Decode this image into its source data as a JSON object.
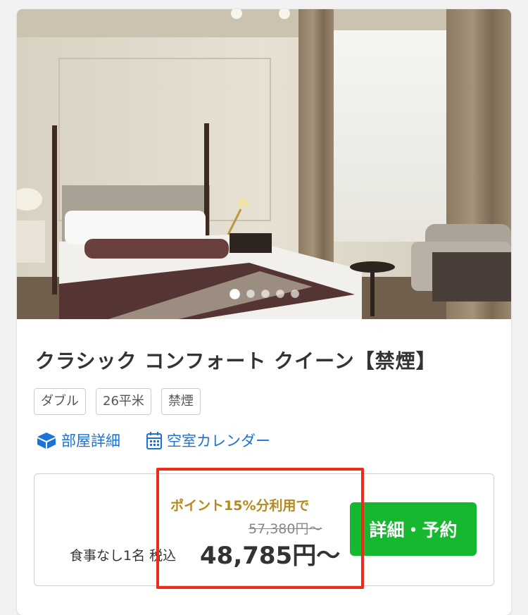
{
  "room": {
    "title": "クラシック コンフォート クイーン【禁煙】",
    "tags": [
      "ダブル",
      "26平米",
      "禁煙"
    ],
    "carousel": {
      "total": 5,
      "active": 1
    }
  },
  "links": {
    "details_label": "部屋詳細",
    "details_icon": "cube-icon",
    "calendar_label": "空室カレンダー",
    "calendar_icon": "calendar-icon"
  },
  "plan": {
    "points_text": "ポイント15%分利用で",
    "original_price": "57,380円〜",
    "meal_info": "食事なし1名 税込",
    "price": "48,785円〜",
    "book_label": "詳細・予約"
  },
  "colors": {
    "link": "#1a73d8",
    "book_button": "#16b82f",
    "points_text": "#b58a1e",
    "highlight": "#ee2a1b"
  }
}
